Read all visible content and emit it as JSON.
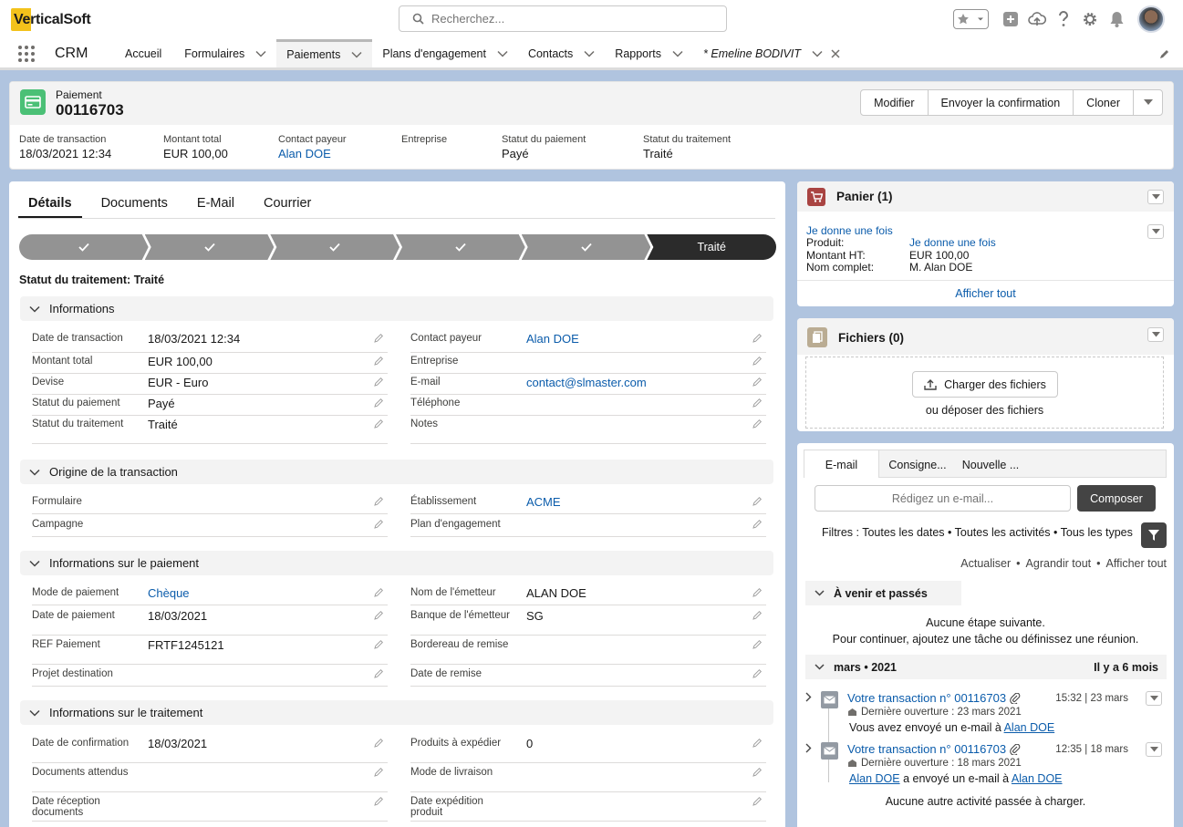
{
  "app": {
    "logo_text": "VerticalSoft",
    "search_placeholder": "Recherchez...",
    "app_name": "CRM"
  },
  "nav": {
    "items": [
      {
        "label": "Accueil"
      },
      {
        "label": "Formulaires"
      },
      {
        "label": "Paiements"
      },
      {
        "label": "Plans d'engagement"
      },
      {
        "label": "Contacts"
      },
      {
        "label": "Rapports"
      },
      {
        "label": "* Emeline BODIVIT"
      }
    ],
    "active": "Paiements"
  },
  "record": {
    "type": "Paiement",
    "name": "00116703",
    "buttons": [
      "Modifier",
      "Envoyer la confirmation",
      "Cloner"
    ],
    "highlights": [
      {
        "label": "Date de transaction",
        "value": "18/03/2021 12:34"
      },
      {
        "label": "Montant total",
        "value": "EUR 100,00"
      },
      {
        "label": "Contact payeur",
        "value": "Alan DOE"
      },
      {
        "label": "Entreprise",
        "value": ""
      },
      {
        "label": "Statut du paiement",
        "value": "Payé"
      },
      {
        "label": "Statut du traitement",
        "value": "Traité"
      }
    ]
  },
  "tabs": [
    "Détails",
    "Documents",
    "E-Mail",
    "Courrier"
  ],
  "path": {
    "final_step": "Traité",
    "status_line": "Statut du traitement: Traité"
  },
  "sections": {
    "informations": {
      "title": "Informations",
      "left": [
        {
          "label": "Date de transaction",
          "value": "18/03/2021 12:34"
        },
        {
          "label": "Montant total",
          "value": "EUR 100,00"
        },
        {
          "label": "Devise",
          "value": "EUR - Euro"
        },
        {
          "label": "Statut du paiement",
          "value": "Payé"
        },
        {
          "label": "Statut du traitement",
          "value": "Traité"
        }
      ],
      "right": [
        {
          "label": "Contact payeur",
          "value": "Alan DOE"
        },
        {
          "label": "Entreprise",
          "value": ""
        },
        {
          "label": "E-mail",
          "value": "contact@slmaster.com"
        },
        {
          "label": "Téléphone",
          "value": ""
        },
        {
          "label": "Notes",
          "value": ""
        }
      ]
    },
    "origine": {
      "title": "Origine de la transaction",
      "left": [
        {
          "label": "Formulaire",
          "value": ""
        },
        {
          "label": "Campagne",
          "value": ""
        }
      ],
      "right": [
        {
          "label": "Établissement",
          "value": "ACME"
        },
        {
          "label": "Plan d'engagement",
          "value": ""
        }
      ]
    },
    "paiement": {
      "title": "Informations sur le paiement",
      "left": [
        {
          "label": "Mode de paiement",
          "value": "Chèque"
        },
        {
          "label": "Date de paiement",
          "value": "18/03/2021"
        },
        {
          "label": "REF Paiement",
          "value": "FRTF1245121"
        },
        {
          "label": "Projet destination",
          "value": ""
        }
      ],
      "right": [
        {
          "label": "Nom de l'émetteur",
          "value": "ALAN DOE"
        },
        {
          "label": "Banque de l'émetteur",
          "value": "SG"
        },
        {
          "label": "Bordereau de remise",
          "value": ""
        },
        {
          "label": "Date de remise",
          "value": ""
        }
      ]
    },
    "traitement": {
      "title": "Informations sur le traitement",
      "left": [
        {
          "label": "Date de confirmation",
          "value": "18/03/2021"
        },
        {
          "label": "Documents attendus",
          "value": ""
        },
        {
          "label": "Date réception documents",
          "value": ""
        }
      ],
      "right": [
        {
          "label": "Produits à expédier",
          "value": "0"
        },
        {
          "label": "Mode de livraison",
          "value": ""
        },
        {
          "label": "Date expédition produit",
          "value": ""
        }
      ]
    }
  },
  "panier": {
    "title": "Panier (1)",
    "item_link": "Je donne une fois",
    "rows": [
      {
        "label": "Produit:",
        "value": "Je donne une fois"
      },
      {
        "label": "Montant HT:",
        "value": "EUR 100,00"
      },
      {
        "label": "Nom complet:",
        "value": "M. Alan DOE"
      }
    ],
    "view_all": "Afficher tout"
  },
  "fichiers": {
    "title": "Fichiers (0)",
    "upload_label": "Charger des fichiers",
    "drop_label": "ou déposer des fichiers"
  },
  "activity": {
    "tabs": [
      "E-mail",
      "Consigne...",
      "Nouvelle ..."
    ],
    "compose_placeholder": "Rédigez un e-mail...",
    "compose_button": "Composer",
    "filters": "Filtres : Toutes les dates • Toutes les activités • Tous les types",
    "links": [
      "Actualiser",
      "Agrandir tout",
      "Afficher tout"
    ],
    "upcoming": {
      "title": "À venir et passés",
      "line1": "Aucune étape suivante.",
      "line2": "Pour continuer, ajoutez une tâche ou définissez une réunion."
    },
    "month": {
      "title": "mars • 2021",
      "ago": "Il y a 6 mois"
    },
    "items": [
      {
        "title": "Votre transaction n° 00116703",
        "sub": "Dernière ouverture : 23 mars 2021",
        "time": "15:32 | 23 mars",
        "body_prefix": "Vous avez envoyé un e-mail à",
        "body_link": "Alan DOE",
        "body_from": ""
      },
      {
        "title": "Votre transaction n° 00116703",
        "sub": "Dernière ouverture : 18 mars 2021",
        "time": "12:35 | 18 mars",
        "body_from": "Alan DOE",
        "body_prefix": "a envoyé un e-mail à",
        "body_link": "Alan DOE"
      }
    ],
    "no_more": "Aucune autre activité passée à charger."
  },
  "colors": {
    "accent_link": "#0b5cab",
    "payment_icon": "#4bc076",
    "cart_icon": "#a94442",
    "files_icon": "#baac93",
    "path_done": "#939393",
    "path_current": "#2b2b2b"
  }
}
